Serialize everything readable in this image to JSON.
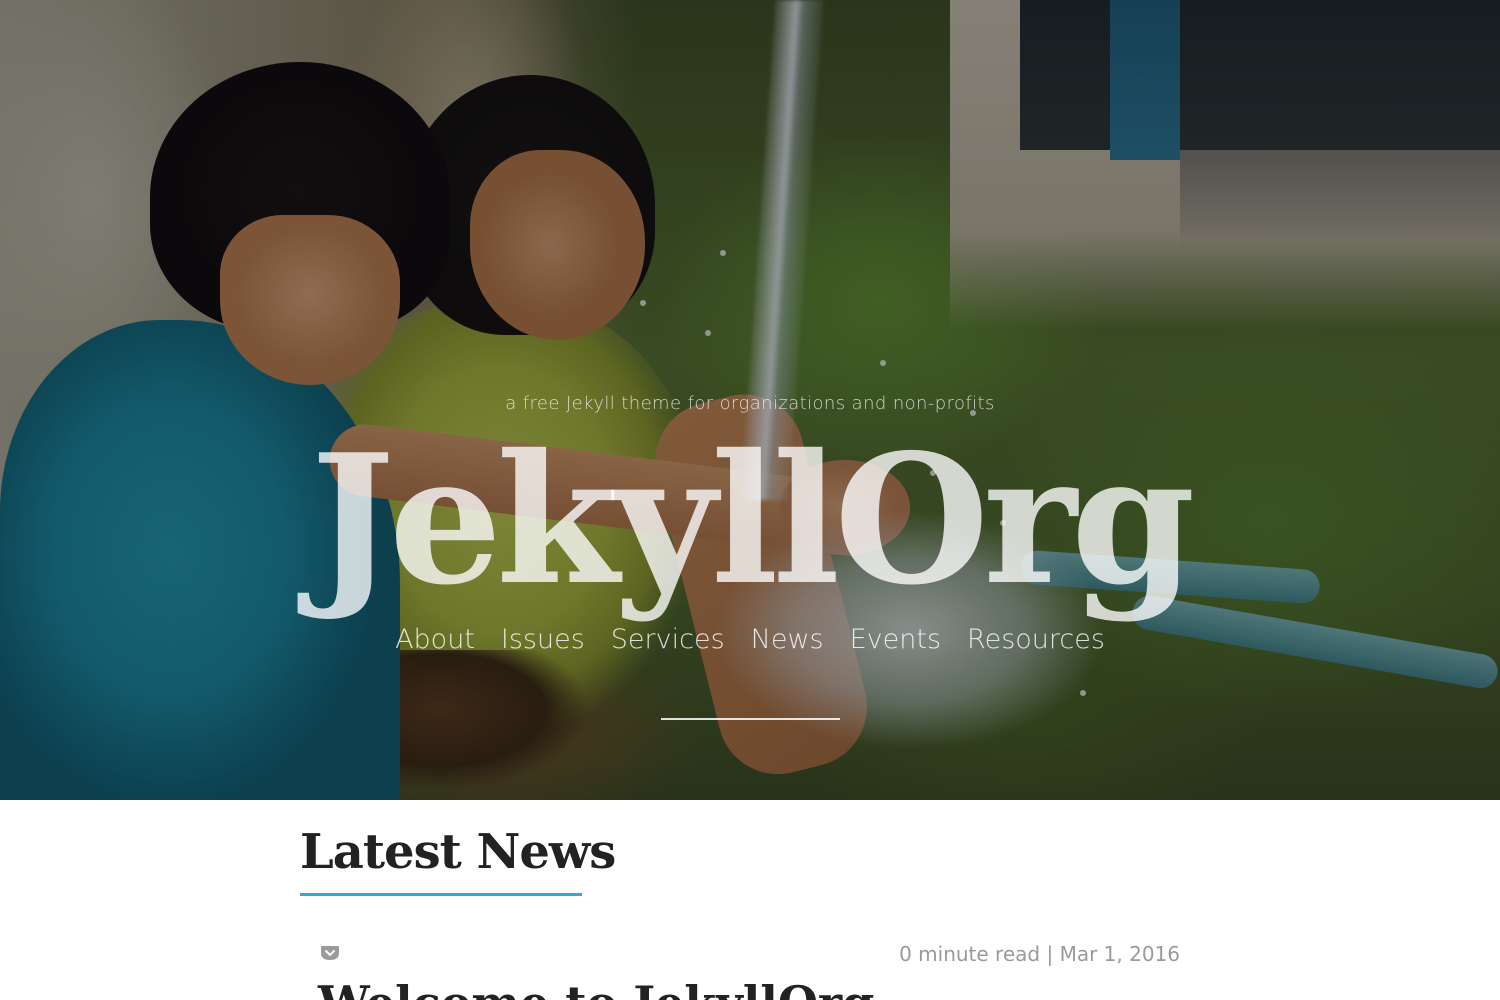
{
  "hero": {
    "tagline": "a free Jekyll theme for organizations and non-profits",
    "title": "JekyllOrg",
    "nav": [
      {
        "label": "About"
      },
      {
        "label": "Issues"
      },
      {
        "label": "Services"
      },
      {
        "label": "News"
      },
      {
        "label": "Events"
      },
      {
        "label": "Resources"
      }
    ]
  },
  "latest_news": {
    "heading": "Latest News",
    "accent_color": "#3ea2d8",
    "post": {
      "save_icon": "pocket-icon",
      "read_time": "0 minute read",
      "separator": "|",
      "date": "Mar 1, 2016",
      "title": "Welcome to JekyllOrg"
    }
  }
}
